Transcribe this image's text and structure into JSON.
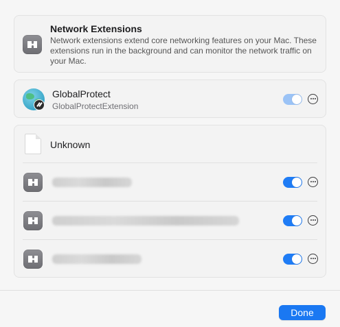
{
  "header": {
    "title": "Network Extensions",
    "description": "Network extensions extend core networking features on your Mac. These extensions run in the background and can monitor the network traffic on your Mac.",
    "icon": "extension-puzzle-icon"
  },
  "globalprotect": {
    "name": "GlobalProtect",
    "subtitle": "GlobalProtectExtension",
    "enabled": true,
    "icon": "globe-icon"
  },
  "unknown_group": {
    "label": "Unknown",
    "icon": "document-icon",
    "items": [
      {
        "enabled": true,
        "icon": "extension-puzzle-icon"
      },
      {
        "enabled": true,
        "icon": "extension-puzzle-icon"
      },
      {
        "enabled": true,
        "icon": "extension-puzzle-icon"
      }
    ]
  },
  "footer": {
    "done_label": "Done"
  },
  "colors": {
    "accent": "#1a78f2",
    "toggle_on": "#1f7cf5",
    "toggle_faded": "#9bc3f6"
  }
}
